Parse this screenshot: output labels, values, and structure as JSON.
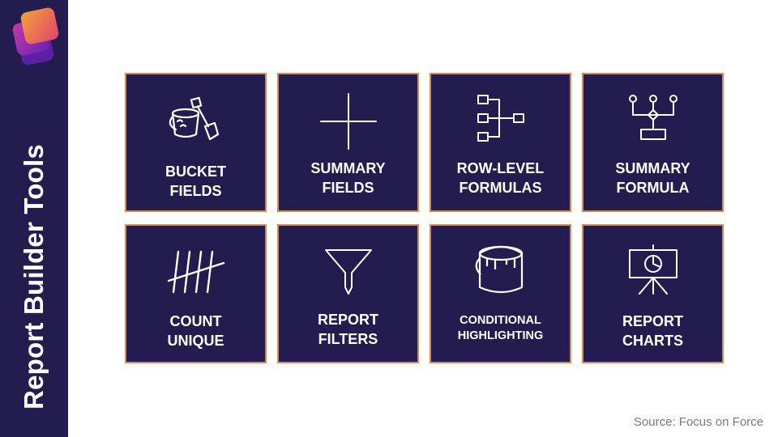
{
  "sidebar": {
    "title": "Report Builder Tools"
  },
  "tiles": [
    {
      "line1": "BUCKET",
      "line2": "FIELDS",
      "icon": "bucket-shovel-icon"
    },
    {
      "line1": "SUMMARY",
      "line2": "FIELDS",
      "icon": "plus-cross-icon"
    },
    {
      "line1": "ROW-LEVEL",
      "line2": "FORMULAS",
      "icon": "hierarchy-flow-icon"
    },
    {
      "line1": "SUMMARY",
      "line2": "FORMULA",
      "icon": "decision-diagram-icon"
    },
    {
      "line1": "COUNT",
      "line2": "UNIQUE",
      "icon": "tally-marks-icon"
    },
    {
      "line1": "REPORT",
      "line2": "FILTERS",
      "icon": "funnel-icon"
    },
    {
      "line1": "CONDITIONAL",
      "line2": "HIGHLIGHTING",
      "icon": "paint-can-icon"
    },
    {
      "line1": "REPORT",
      "line2": "CHARTS",
      "icon": "presentation-chart-icon"
    }
  ],
  "footer": {
    "source": "Source: Focus on Force"
  },
  "colors": {
    "navy": "#221d4e",
    "tile_border": "#d98a4e",
    "logo_orange": "#f0823a",
    "logo_purple": "#7b2fbe"
  }
}
